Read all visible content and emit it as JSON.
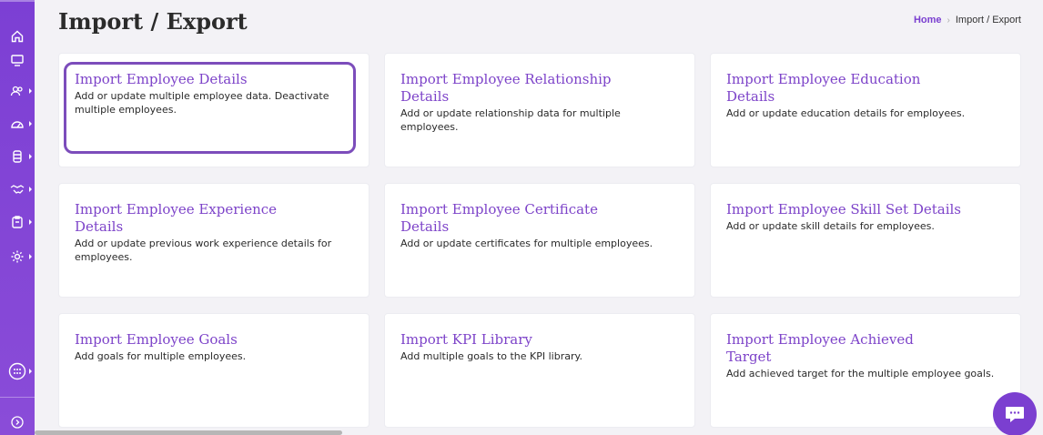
{
  "header": {
    "title": "Import / Export",
    "breadcrumb": {
      "home": "Home",
      "separator": "›",
      "current": "Import / Export"
    }
  },
  "sidebar": {
    "items": [
      {
        "icon": "home-icon"
      },
      {
        "icon": "monitor-icon"
      },
      {
        "icon": "users-icon"
      },
      {
        "icon": "dashboard-gauge-icon"
      },
      {
        "icon": "database-icon"
      },
      {
        "icon": "handshake-icon"
      },
      {
        "icon": "clipboard-icon"
      },
      {
        "icon": "settings-icon"
      },
      {
        "icon": "apps-grid-icon"
      },
      {
        "icon": "expand-arrow-icon"
      }
    ]
  },
  "cards": [
    {
      "title": "Import Employee Details",
      "description": "Add or update multiple employee data. Deactivate multiple employees."
    },
    {
      "title": "Import Employee Relationship Details",
      "description": "Add or update relationship data for multiple employees."
    },
    {
      "title": "Import Employee Education Details",
      "description": "Add or update education details for employees."
    },
    {
      "title": "Import Employee Experience Details",
      "description": "Add or update previous work experience details for employees."
    },
    {
      "title": "Import Employee Certificate Details",
      "description": "Add or update certificates for multiple employees."
    },
    {
      "title": "Import Employee Skill Set Details",
      "description": "Add or update skill details for employees."
    },
    {
      "title": "Import Employee Goals",
      "description": "Add goals for multiple employees."
    },
    {
      "title": "Import KPI Library",
      "description": "Add multiple goals to the KPI library."
    },
    {
      "title": "Import Employee Achieved Target",
      "description": "Add achieved target for the multiple employee goals."
    }
  ],
  "colors": {
    "accent": "#7d43c9",
    "sidebar": "#7c3fd4",
    "background": "#f3f2f6"
  }
}
